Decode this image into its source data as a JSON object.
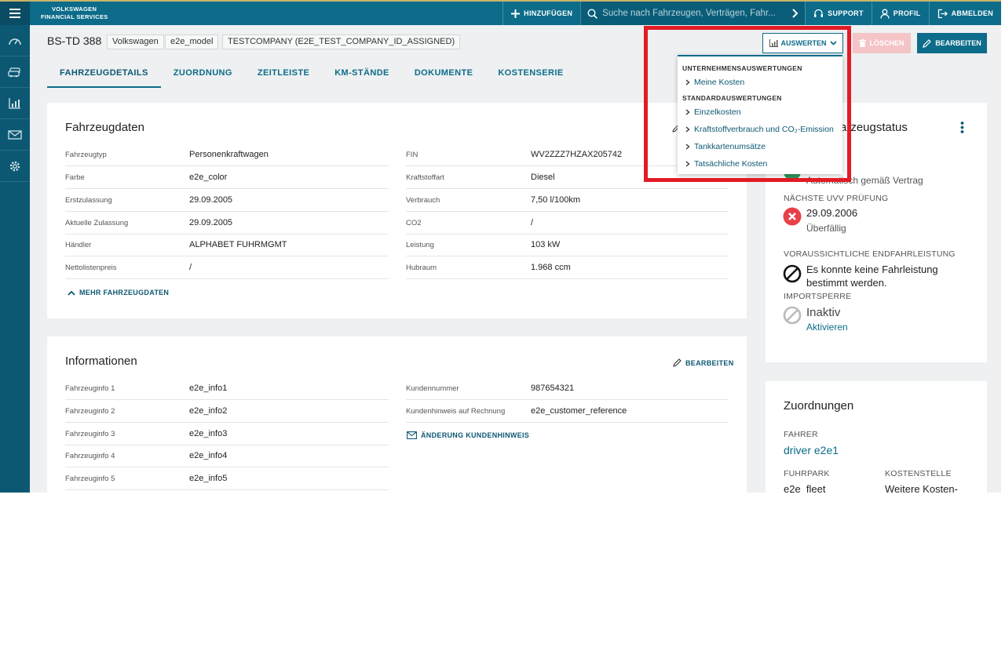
{
  "brand": {
    "line1": "VOLKSWAGEN",
    "line2": "FINANCIAL SERVICES"
  },
  "topbar": {
    "add_label": "HINZUFÜGEN",
    "search_placeholder": "Suche nach Fahrzeugen, Verträgen, Fahr...",
    "support_label": "SUPPORT",
    "profile_label": "PROFIL",
    "logout_label": "ABMELDEN"
  },
  "vehicle": {
    "plate": "BS-TD 388",
    "tags": [
      "Volkswagen",
      "e2e_model",
      "TESTCOMPANY (E2E_TEST_COMPANY_ID_ASSIGNED)"
    ]
  },
  "actions": {
    "evaluate": "AUSWERTEN",
    "delete": "LÖSCHEN",
    "edit": "BEARBEITEN"
  },
  "tabs": [
    "FAHRZEUGDETAILS",
    "ZUORDNUNG",
    "ZEITLEISTE",
    "KM-STÄNDE",
    "DOKUMENTE",
    "KOSTENSERIE"
  ],
  "fahrzeugdaten": {
    "title": "Fahrzeugdaten",
    "left": [
      {
        "label": "Fahrzeugtyp",
        "value": "Personenkraftwagen"
      },
      {
        "label": "Farbe",
        "value": "e2e_color"
      },
      {
        "label": "Erstzulassung",
        "value": "29.09.2005"
      },
      {
        "label": "Aktuelle Zulassung",
        "value": "29.09.2005"
      },
      {
        "label": "Händler",
        "value": "ALPHABET FUHRMGMT"
      },
      {
        "label": "Nettolistenpreis",
        "value": "/"
      }
    ],
    "right": [
      {
        "label": "FIN",
        "value": "WV2ZZZ7HZAX205742"
      },
      {
        "label": "Kraftstoffart",
        "value": "Diesel"
      },
      {
        "label": "Verbrauch",
        "value": "7,50 l/100km"
      },
      {
        "label": "CO2",
        "value": "/"
      },
      {
        "label": "Leistung",
        "value": "103 kW"
      },
      {
        "label": "Hubraum",
        "value": "1.968 ccm"
      }
    ],
    "more_link": "MEHR FAHRZEUGDATEN"
  },
  "informationen": {
    "title": "Informationen",
    "edit_label": "BEARBEITEN",
    "left": [
      {
        "label": "Fahrzeuginfo 1",
        "value": "e2e_info1"
      },
      {
        "label": "Fahrzeuginfo 2",
        "value": "e2e_info2"
      },
      {
        "label": "Fahrzeuginfo 3",
        "value": "e2e_info3"
      },
      {
        "label": "Fahrzeuginfo 4",
        "value": "e2e_info4"
      },
      {
        "label": "Fahrzeuginfo 5",
        "value": "e2e_info5"
      }
    ],
    "right": [
      {
        "label": "Kundennummer",
        "value": "987654321"
      },
      {
        "label": "Kundenhinweis auf Rechnung",
        "value": "e2e_customer_reference"
      }
    ],
    "change_link": "ÄNDERUNG KUNDENHINWEIS"
  },
  "status": {
    "title_visible": "arzeugstatus",
    "auto_text": "Automatisch gemäß Vertrag",
    "uvv_label": "NÄCHSTE UVV PRÜFUNG",
    "uvv_date": "29.09.2006",
    "uvv_state": "Überfällig",
    "endleistung_label": "VORAUSSICHTLICHE ENDFAHRLEISTUNG",
    "endleistung_line1": "Es konnte keine Fahrleistung",
    "endleistung_line2": "bestimmt werden.",
    "import_label": "IMPORTSPERRE",
    "import_state": "Inaktiv",
    "import_link": "Aktivieren"
  },
  "zuordnungen": {
    "title": "Zuordnungen",
    "driver_label": "FAHRER",
    "driver_value": "driver e2e1",
    "fleet_label": "FUHRPARK",
    "fleet_value": "e2e_fleet",
    "cost_label": "KOSTENSTELLE",
    "cost_value": "Weitere Kosten-"
  },
  "dropdown": {
    "section1": "UNTERNEHMENSAUSWERTUNGEN",
    "section1_items": [
      "Meine Kosten"
    ],
    "section2": "STANDARDAUSWERTUNGEN",
    "section2_items": [
      "Einzelkosten",
      "Kraftstoffverbrauch und CO₂-Emission",
      "Tankkartenumsätze",
      "Tatsächliche Kosten"
    ]
  },
  "colors": {
    "primary": "#0c6c8a",
    "sidebar": "#0c5873",
    "danger": "#e21b25",
    "danger_light": "#f4c4c6",
    "success": "#2e9a5c"
  }
}
